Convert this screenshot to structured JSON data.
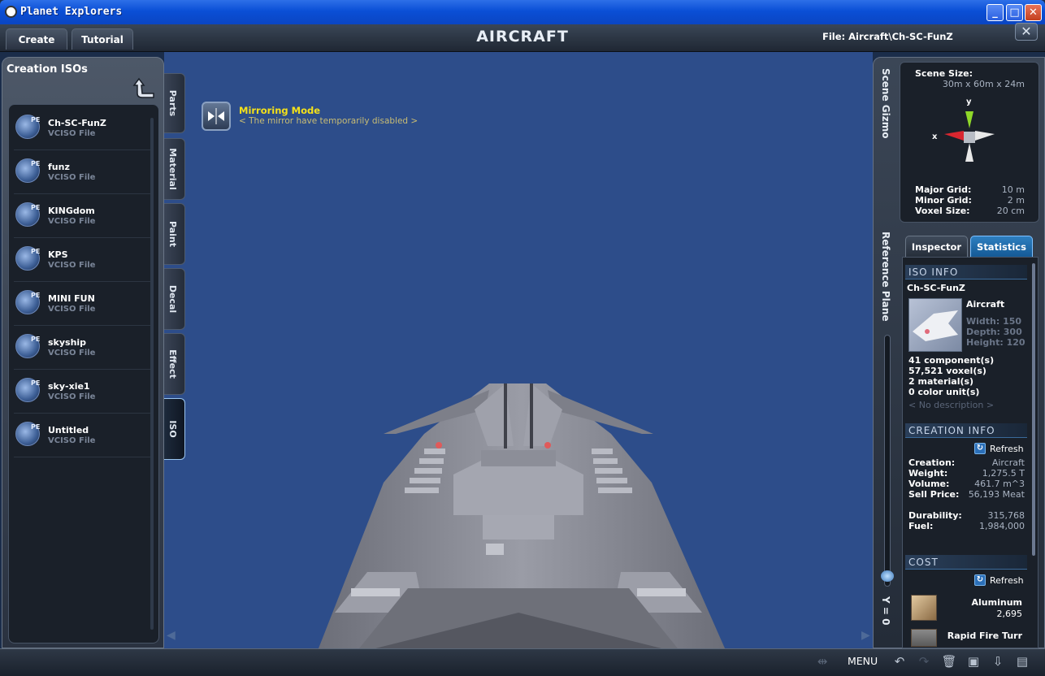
{
  "window": {
    "title": "Planet Explorers",
    "min_icon": "minimize-icon",
    "max_icon": "maximize-icon",
    "close_icon": "close-icon"
  },
  "topbar": {
    "tabs": [
      {
        "label": "Create"
      },
      {
        "label": "Tutorial"
      }
    ],
    "title": "AIRCRAFT",
    "file_label": "File:  Aircraft\\Ch-SC-FunZ",
    "close_glyph": "✕"
  },
  "mirroring": {
    "title": "Mirroring Mode",
    "subtitle": "< The mirror have temporarily disabled >"
  },
  "left_panel": {
    "title": "Creation ISOs",
    "items": [
      {
        "name": "Ch-SC-FunZ",
        "type": "VCISO File",
        "badge": "PE"
      },
      {
        "name": "funz",
        "type": "VCISO File",
        "badge": "PE"
      },
      {
        "name": "KINGdom",
        "type": "VCISO File",
        "badge": "PE"
      },
      {
        "name": "KPS",
        "type": "VCISO File",
        "badge": "PE"
      },
      {
        "name": "MINI FUN",
        "type": "VCISO File",
        "badge": "PE"
      },
      {
        "name": "skyship",
        "type": "VCISO File",
        "badge": "PE"
      },
      {
        "name": "sky-xie1",
        "type": "VCISO File",
        "badge": "PE"
      },
      {
        "name": "Untitled",
        "type": "VCISO File",
        "badge": "PE"
      }
    ]
  },
  "side_tabs": [
    {
      "label": "Parts"
    },
    {
      "label": "Material"
    },
    {
      "label": "Paint"
    },
    {
      "label": "Decal"
    },
    {
      "label": "Effect"
    },
    {
      "label": "ISO",
      "active": true
    }
  ],
  "right_panel": {
    "scene_gizmo_label": "Scene Gizmo",
    "reference_plane_label": "Reference Plane",
    "y_label": "Y = 0",
    "scene_size_label": "Scene Size:",
    "scene_size_value": "30m x 60m x 24m",
    "axis_y": "y",
    "axis_x": "x",
    "major_grid_label": "Major Grid:",
    "major_grid_value": "10 m",
    "minor_grid_label": "Minor Grid:",
    "minor_grid_value": "2 m",
    "voxel_size_label": "Voxel Size:",
    "voxel_size_value": "20 cm",
    "tabs": [
      {
        "label": "Inspector"
      },
      {
        "label": "Statistics",
        "active": true
      }
    ]
  },
  "stats": {
    "iso_info_header": "ISO INFO",
    "iso_name": "Ch-SC-FunZ",
    "category": "Aircraft",
    "width": "Width: 150",
    "depth": "Depth: 300",
    "height": "Height: 120",
    "components": "41 component(s)",
    "voxels": "57,521 voxel(s)",
    "materials": "2 material(s)",
    "color_units": "0 color unit(s)",
    "description": "< No description >",
    "creation_info_header": "CREATION INFO",
    "refresh_label": "Refresh",
    "creation_label": "Creation:",
    "creation_value": "Aircraft",
    "weight_label": "Weight:",
    "weight_value": "1,275.5 T",
    "volume_label": "Volume:",
    "volume_value": "461.7 m^3",
    "sell_label": "Sell Price:",
    "sell_value": "56,193 Meat",
    "durability_label": "Durability:",
    "durability_value": "315,768",
    "fuel_label": "Fuel:",
    "fuel_value": "1,984,000",
    "cost_header": "COST",
    "cost_refresh_label": "Refresh",
    "cost_items": [
      {
        "name": "Aluminum",
        "amount": "2,695"
      },
      {
        "name": "Rapid Fire Turr",
        "amount": ""
      }
    ]
  },
  "bottombar": {
    "menu_label": "MENU"
  },
  "colors": {
    "accent": "#2e7fc0",
    "mirror_title": "#f4e11a",
    "viewport": "#2d4d8a"
  }
}
